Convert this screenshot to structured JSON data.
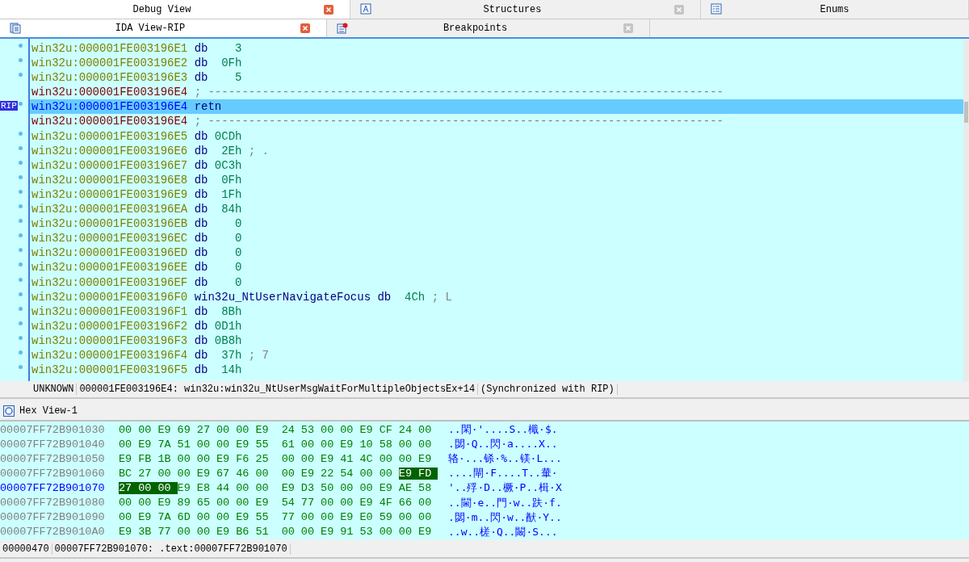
{
  "tab_row_1": [
    {
      "label": "Debug View",
      "closable": true,
      "selected": true
    },
    {
      "label": "Structures",
      "closable": true,
      "selected": false
    },
    {
      "label": "Enums",
      "closable": false,
      "selected": false
    }
  ],
  "tab_row_2": [
    {
      "label": "IDA View-RIP",
      "closable": true,
      "selected": true
    },
    {
      "label": "Breakpoints",
      "closable": true,
      "selected": false
    }
  ],
  "disassembly": {
    "lines": [
      {
        "address": "win32u:000001FE003196E1",
        "kind": "data",
        "mnemonic": "db",
        "operand": "3",
        "dot": true,
        "selected": false
      },
      {
        "address": "win32u:000001FE003196E2",
        "kind": "data",
        "mnemonic": "db",
        "operand": "0Fh",
        "dot": true,
        "selected": false
      },
      {
        "address": "win32u:000001FE003196E3",
        "kind": "data",
        "mnemonic": "db",
        "operand": "5",
        "dot": true,
        "selected": false
      },
      {
        "address": "win32u:000001FE003196E4",
        "kind": "separator",
        "text": "; ----------------------------------------------------------------------------",
        "dot": false,
        "selected": false
      },
      {
        "address": "win32u:000001FE003196E4",
        "kind": "code",
        "mnemonic": "retn",
        "marker": "RIP",
        "dot": true,
        "selected": true
      },
      {
        "address": "win32u:000001FE003196E4",
        "kind": "separator",
        "text": "; ----------------------------------------------------------------------------",
        "dot": false,
        "selected": false
      },
      {
        "address": "win32u:000001FE003196E5",
        "kind": "data",
        "mnemonic": "db",
        "operand": "0CDh",
        "dot": true,
        "selected": false
      },
      {
        "address": "win32u:000001FE003196E6",
        "kind": "data",
        "mnemonic": "db",
        "operand": "2Eh",
        "comment": "; .",
        "dot": true,
        "selected": false
      },
      {
        "address": "win32u:000001FE003196E7",
        "kind": "data",
        "mnemonic": "db",
        "operand": "0C3h",
        "dot": true,
        "selected": false
      },
      {
        "address": "win32u:000001FE003196E8",
        "kind": "data",
        "mnemonic": "db",
        "operand": "0Fh",
        "dot": true,
        "selected": false
      },
      {
        "address": "win32u:000001FE003196E9",
        "kind": "data",
        "mnemonic": "db",
        "operand": "1Fh",
        "dot": true,
        "selected": false
      },
      {
        "address": "win32u:000001FE003196EA",
        "kind": "data",
        "mnemonic": "db",
        "operand": "84h",
        "dot": true,
        "selected": false
      },
      {
        "address": "win32u:000001FE003196EB",
        "kind": "data",
        "mnemonic": "db",
        "operand": "0",
        "dot": true,
        "selected": false
      },
      {
        "address": "win32u:000001FE003196EC",
        "kind": "data",
        "mnemonic": "db",
        "operand": "0",
        "dot": true,
        "selected": false
      },
      {
        "address": "win32u:000001FE003196ED",
        "kind": "data",
        "mnemonic": "db",
        "operand": "0",
        "dot": true,
        "selected": false
      },
      {
        "address": "win32u:000001FE003196EE",
        "kind": "data",
        "mnemonic": "db",
        "operand": "0",
        "dot": true,
        "selected": false
      },
      {
        "address": "win32u:000001FE003196EF",
        "kind": "data",
        "mnemonic": "db",
        "operand": "0",
        "dot": true,
        "selected": false
      },
      {
        "address": "win32u:000001FE003196F0",
        "kind": "data",
        "label": "win32u_NtUserNavigateFocus",
        "mnemonic": "db",
        "operand": "4Ch",
        "comment": "; L",
        "dot": true,
        "selected": false
      },
      {
        "address": "win32u:000001FE003196F1",
        "kind": "data",
        "mnemonic": "db",
        "operand": "8Bh",
        "dot": true,
        "selected": false
      },
      {
        "address": "win32u:000001FE003196F2",
        "kind": "data",
        "mnemonic": "db",
        "operand": "0D1h",
        "dot": true,
        "selected": false
      },
      {
        "address": "win32u:000001FE003196F3",
        "kind": "data",
        "mnemonic": "db",
        "operand": "0B8h",
        "dot": true,
        "selected": false
      },
      {
        "address": "win32u:000001FE003196F4",
        "kind": "data",
        "mnemonic": "db",
        "operand": "37h",
        "comment": "; 7",
        "dot": true,
        "selected": false
      },
      {
        "address": "win32u:000001FE003196F5",
        "kind": "data",
        "mnemonic": "db",
        "operand": "14h",
        "dot": true,
        "selected": false
      }
    ],
    "status": [
      "UNKNOWN",
      "000001FE003196E4: win32u:win32u_NtUserMsgWaitForMultipleObjectsEx+14",
      "(Synchronized with RIP)"
    ]
  },
  "hex_view": {
    "title": "Hex View-1",
    "rows": [
      {
        "address": "00007FF72B901030",
        "current": false,
        "bytes": [
          {
            "v": "00",
            "selected": false
          },
          {
            "v": "00",
            "selected": false
          },
          {
            "v": "E9",
            "selected": false
          },
          {
            "v": "69",
            "selected": false
          },
          {
            "v": "27",
            "selected": false
          },
          {
            "v": "00",
            "selected": false
          },
          {
            "v": "00",
            "selected": false
          },
          {
            "v": "E9",
            "selected": false
          },
          {
            "v": "24",
            "selected": false
          },
          {
            "v": "53",
            "selected": false
          },
          {
            "v": "00",
            "selected": false
          },
          {
            "v": "00",
            "selected": false
          },
          {
            "v": "E9",
            "selected": false
          },
          {
            "v": "CF",
            "selected": false
          },
          {
            "v": "24",
            "selected": false
          },
          {
            "v": "00",
            "selected": false
          }
        ],
        "ascii": "..閑·'....S..檝·$."
      },
      {
        "address": "00007FF72B901040",
        "current": false,
        "bytes": [
          {
            "v": "00",
            "selected": false
          },
          {
            "v": "E9",
            "selected": false
          },
          {
            "v": "7A",
            "selected": false
          },
          {
            "v": "51",
            "selected": false
          },
          {
            "v": "00",
            "selected": false
          },
          {
            "v": "00",
            "selected": false
          },
          {
            "v": "E9",
            "selected": false
          },
          {
            "v": "55",
            "selected": false
          },
          {
            "v": "61",
            "selected": false
          },
          {
            "v": "00",
            "selected": false
          },
          {
            "v": "00",
            "selected": false
          },
          {
            "v": "E9",
            "selected": false
          },
          {
            "v": "10",
            "selected": false
          },
          {
            "v": "58",
            "selected": false
          },
          {
            "v": "00",
            "selected": false
          },
          {
            "v": "00",
            "selected": false
          }
        ],
        "ascii": ".閟·Q..閃·a....X.."
      },
      {
        "address": "00007FF72B901050",
        "current": false,
        "bytes": [
          {
            "v": "E9",
            "selected": false
          },
          {
            "v": "FB",
            "selected": false
          },
          {
            "v": "1B",
            "selected": false
          },
          {
            "v": "00",
            "selected": false
          },
          {
            "v": "00",
            "selected": false
          },
          {
            "v": "E9",
            "selected": false
          },
          {
            "v": "F6",
            "selected": false
          },
          {
            "v": "25",
            "selected": false
          },
          {
            "v": "00",
            "selected": false
          },
          {
            "v": "00",
            "selected": false
          },
          {
            "v": "E9",
            "selected": false
          },
          {
            "v": "41",
            "selected": false
          },
          {
            "v": "4C",
            "selected": false
          },
          {
            "v": "00",
            "selected": false
          },
          {
            "v": "00",
            "selected": false
          },
          {
            "v": "E9",
            "selected": false
          }
        ],
        "ascii": "辂·...铩·%..镁·L..."
      },
      {
        "address": "00007FF72B901060",
        "current": false,
        "bytes": [
          {
            "v": "BC",
            "selected": false
          },
          {
            "v": "27",
            "selected": false
          },
          {
            "v": "00",
            "selected": false
          },
          {
            "v": "00",
            "selected": false
          },
          {
            "v": "E9",
            "selected": false
          },
          {
            "v": "67",
            "selected": false
          },
          {
            "v": "46",
            "selected": false
          },
          {
            "v": "00",
            "selected": false
          },
          {
            "v": "00",
            "selected": false
          },
          {
            "v": "E9",
            "selected": false
          },
          {
            "v": "22",
            "selected": false
          },
          {
            "v": "54",
            "selected": false
          },
          {
            "v": "00",
            "selected": false
          },
          {
            "v": "00",
            "selected": false
          },
          {
            "v": "E9",
            "selected": true
          },
          {
            "v": "FD",
            "selected": true
          }
        ],
        "ascii": "....閘·F....T..輂·"
      },
      {
        "address": "00007FF72B901070",
        "current": true,
        "bytes": [
          {
            "v": "27",
            "selected": true
          },
          {
            "v": "00",
            "selected": true
          },
          {
            "v": "00",
            "selected": true
          },
          {
            "v": "E9",
            "selected": false
          },
          {
            "v": "E8",
            "selected": false
          },
          {
            "v": "44",
            "selected": false
          },
          {
            "v": "00",
            "selected": false
          },
          {
            "v": "00",
            "selected": false
          },
          {
            "v": "E9",
            "selected": false
          },
          {
            "v": "D3",
            "selected": false
          },
          {
            "v": "50",
            "selected": false
          },
          {
            "v": "00",
            "selected": false
          },
          {
            "v": "00",
            "selected": false
          },
          {
            "v": "E9",
            "selected": false
          },
          {
            "v": "AE",
            "selected": false
          },
          {
            "v": "58",
            "selected": false
          }
        ],
        "ascii": "'..殍·D..橛·P..楫·X"
      },
      {
        "address": "00007FF72B901080",
        "current": false,
        "bytes": [
          {
            "v": "00",
            "selected": false
          },
          {
            "v": "00",
            "selected": false
          },
          {
            "v": "E9",
            "selected": false
          },
          {
            "v": "89",
            "selected": false
          },
          {
            "v": "65",
            "selected": false
          },
          {
            "v": "00",
            "selected": false
          },
          {
            "v": "00",
            "selected": false
          },
          {
            "v": "E9",
            "selected": false
          },
          {
            "v": "54",
            "selected": false
          },
          {
            "v": "77",
            "selected": false
          },
          {
            "v": "00",
            "selected": false
          },
          {
            "v": "00",
            "selected": false
          },
          {
            "v": "E9",
            "selected": false
          },
          {
            "v": "4F",
            "selected": false
          },
          {
            "v": "66",
            "selected": false
          },
          {
            "v": "00",
            "selected": false
          }
        ],
        "ascii": "..閫·e..門·w..趺·f."
      },
      {
        "address": "00007FF72B901090",
        "current": false,
        "bytes": [
          {
            "v": "00",
            "selected": false
          },
          {
            "v": "E9",
            "selected": false
          },
          {
            "v": "7A",
            "selected": false
          },
          {
            "v": "6D",
            "selected": false
          },
          {
            "v": "00",
            "selected": false
          },
          {
            "v": "00",
            "selected": false
          },
          {
            "v": "E9",
            "selected": false
          },
          {
            "v": "55",
            "selected": false
          },
          {
            "v": "77",
            "selected": false
          },
          {
            "v": "00",
            "selected": false
          },
          {
            "v": "00",
            "selected": false
          },
          {
            "v": "E9",
            "selected": false
          },
          {
            "v": "E0",
            "selected": false
          },
          {
            "v": "59",
            "selected": false
          },
          {
            "v": "00",
            "selected": false
          },
          {
            "v": "00",
            "selected": false
          }
        ],
        "ascii": ".閟·m..閃·w..猷·Y.."
      },
      {
        "address": "00007FF72B9010A0",
        "current": false,
        "bytes": [
          {
            "v": "E9",
            "selected": false
          },
          {
            "v": "3B",
            "selected": false
          },
          {
            "v": "77",
            "selected": false
          },
          {
            "v": "00",
            "selected": false
          },
          {
            "v": "00",
            "selected": false
          },
          {
            "v": "E9",
            "selected": false
          },
          {
            "v": "B6",
            "selected": false
          },
          {
            "v": "51",
            "selected": false
          },
          {
            "v": "00",
            "selected": false
          },
          {
            "v": "00",
            "selected": false
          },
          {
            "v": "E9",
            "selected": false
          },
          {
            "v": "91",
            "selected": false
          },
          {
            "v": "53",
            "selected": false
          },
          {
            "v": "00",
            "selected": false
          },
          {
            "v": "00",
            "selected": false
          },
          {
            "v": "E9",
            "selected": false
          }
        ],
        "ascii": "..w..槎·Q..闞·S..."
      }
    ],
    "status": [
      "00000470",
      "00007FF72B901070: .text:00007FF72B901070"
    ]
  }
}
